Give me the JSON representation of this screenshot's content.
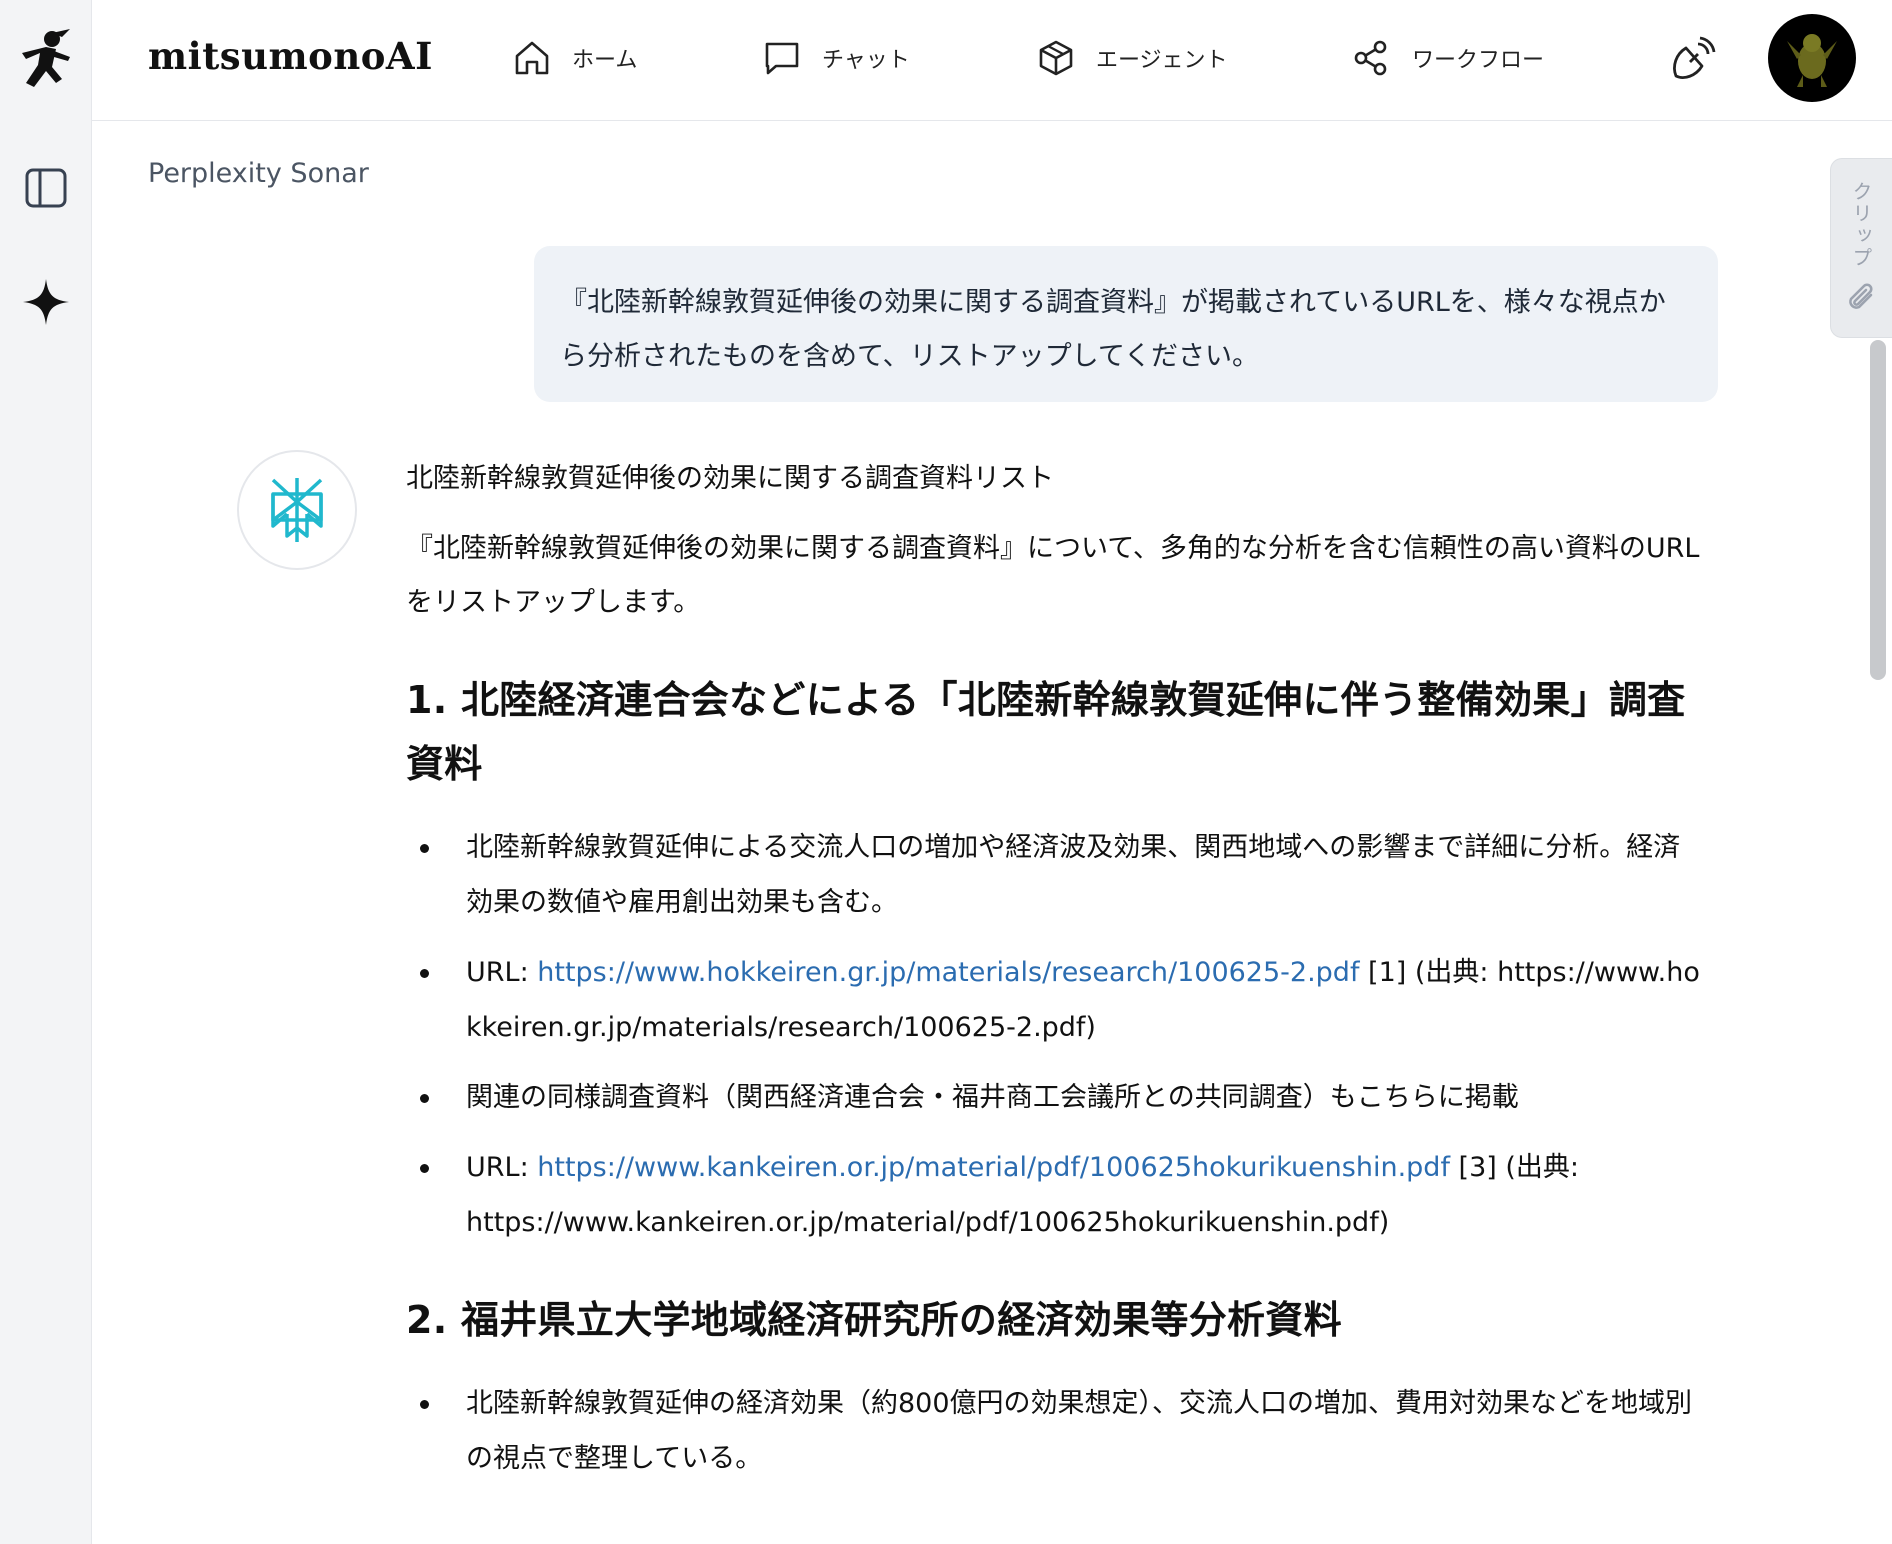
{
  "app": {
    "brand": "mitsumonoAI"
  },
  "rail": {
    "items": [
      {
        "name": "ninja-logo-icon"
      },
      {
        "name": "sidebar-toggle-icon"
      },
      {
        "name": "sparkle-icon"
      }
    ]
  },
  "nav": {
    "home": "ホーム",
    "chat": "チャット",
    "agent": "エージェント",
    "workflow": "ワークフロー"
  },
  "chat": {
    "model": "Perplexity Sonar",
    "user_message": "『北陸新幹線敦賀延伸後の効果に関する調査資料』が掲載されているURLを、様々な視点から分析されたものを含めて、リストアップしてください。",
    "answer": {
      "title": "北陸新幹線敦賀延伸後の効果に関する調査資料リスト",
      "intro": "『北陸新幹線敦賀延伸後の効果に関する調査資料』について、多角的な分析を含む信頼性の高い資料のURLをリストアップします。",
      "sections": [
        {
          "heading": "1. 北陸経済連合会などによる「北陸新幹線敦賀延伸に伴う整備効果」調査資料",
          "bullet1": "北陸新幹線敦賀延伸による交流人口の増加や経済波及効果、関西地域への影響まで詳細に分析。経済効果の数値や雇用創出効果も含む。",
          "bullet2_prefix": "URL: ",
          "bullet2_link": "https://www.hokkeiren.gr.jp/materials/research/100625-2.pdf",
          "bullet2_suffix": " [1] (出典: https://www.hokkeiren.gr.jp/materials/research/100625-2.pdf)",
          "bullet3": "関連の同様調査資料（関西経済連合会・福井商工会議所との共同調査）もこちらに掲載",
          "bullet4_prefix": "URL: ",
          "bullet4_link": "https://www.kankeiren.or.jp/material/pdf/100625hokurikuenshin.pdf",
          "bullet4_suffix": " [3] (出典: https://www.kankeiren.or.jp/material/pdf/100625hokurikuenshin.pdf)"
        },
        {
          "heading": "2. 福井県立大学地域経済研究所の経済効果等分析資料",
          "bullet1": "北陸新幹線敦賀延伸の経済効果（約800億円の効果想定）、交流人口の増加、費用対効果などを地域別の視点で整理している。"
        }
      ]
    }
  },
  "clip": {
    "label": "クリップ"
  },
  "colors": {
    "link": "#2b6cb0",
    "bubble": "#eef2f7",
    "perplexity": "#20b8cd"
  }
}
